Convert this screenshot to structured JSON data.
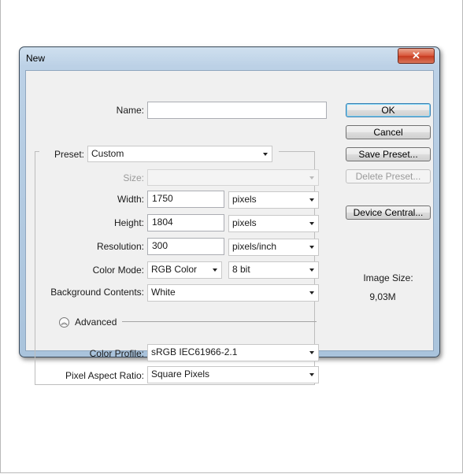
{
  "window": {
    "title": "New",
    "close_label": "✕"
  },
  "form": {
    "name": {
      "label": "Name:",
      "value": ""
    },
    "preset": {
      "label": "Preset:",
      "value": "Custom"
    },
    "size": {
      "label": "Size:",
      "value": ""
    },
    "width": {
      "label": "Width:",
      "value": "1750",
      "unit": "pixels"
    },
    "height": {
      "label": "Height:",
      "value": "1804",
      "unit": "pixels"
    },
    "resolution": {
      "label": "Resolution:",
      "value": "300",
      "unit": "pixels/inch"
    },
    "color_mode": {
      "label": "Color Mode:",
      "value": "RGB Color",
      "depth": "8 bit"
    },
    "background": {
      "label": "Background Contents:",
      "value": "White"
    },
    "advanced": {
      "label": "Advanced",
      "icon": "chevron-up-circle-icon"
    },
    "color_profile": {
      "label": "Color Profile:",
      "value": "sRGB IEC61966-2.1"
    },
    "pixel_aspect": {
      "label": "Pixel Aspect Ratio:",
      "value": "Square Pixels"
    }
  },
  "buttons": {
    "ok": "OK",
    "cancel": "Cancel",
    "save_preset": "Save Preset...",
    "delete_preset": "Delete Preset...",
    "device_central": "Device Central..."
  },
  "image_size": {
    "label": "Image Size:",
    "value": "9,03M"
  },
  "colors": {
    "title_bar": "#bcd1e6",
    "close_button": "#c63a1f",
    "dialog_bg": "#f0f0f0",
    "default_button_border": "#3c7fb1"
  }
}
